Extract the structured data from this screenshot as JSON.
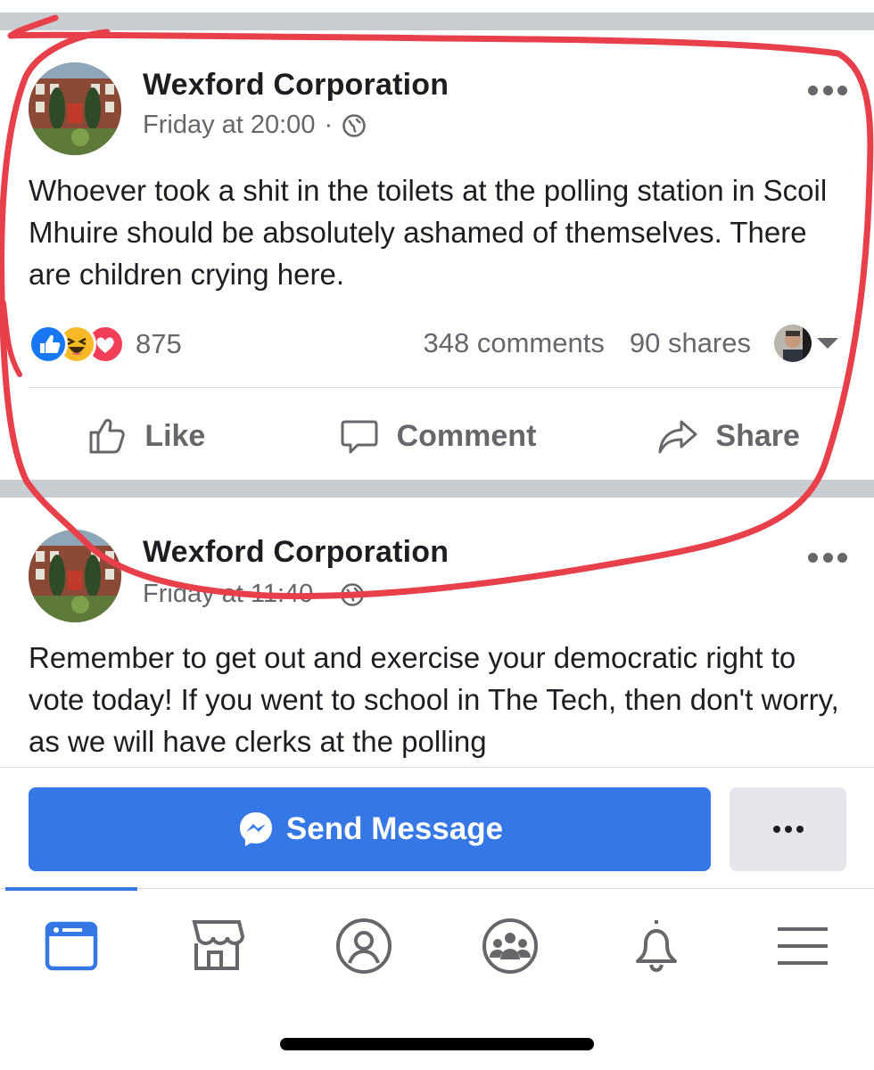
{
  "posts": [
    {
      "page_name": "Wexford Corporation",
      "timestamp": "Friday at 20:00",
      "separator": "·",
      "privacy_icon": "globe-icon",
      "text": "Whoever took a shit in the toilets at the polling station in Scoil Mhuire should be absolutely ashamed of themselves. There are children crying here.",
      "reactions": [
        "like",
        "haha",
        "love"
      ],
      "reaction_count": "875",
      "comments": "348 comments",
      "shares": "90 shares",
      "actions": {
        "like": "Like",
        "comment": "Comment",
        "share": "Share"
      }
    },
    {
      "page_name": "Wexford Corporation",
      "timestamp": "Friday at 11:40",
      "separator": "·",
      "privacy_icon": "globe-icon",
      "text": "Remember to get out and exercise your democratic right to vote today! If you went to school in The Tech, then don't worry, as we will have clerks at the polling"
    }
  ],
  "composer": {
    "send_message_label": "Send Message",
    "messenger_icon": "messenger-icon",
    "more_icon": "more-icon"
  },
  "tabbar": {
    "items": [
      "news-feed-icon",
      "marketplace-icon",
      "profile-icon",
      "groups-icon",
      "notifications-icon",
      "menu-icon"
    ],
    "active": "news-feed-icon",
    "accent": "#3578e5"
  },
  "colors": {
    "brand_blue": "#3578e5",
    "annotation_red": "#e8404b",
    "separator_gray": "#c9ccd1",
    "meta_gray": "#65676b"
  }
}
